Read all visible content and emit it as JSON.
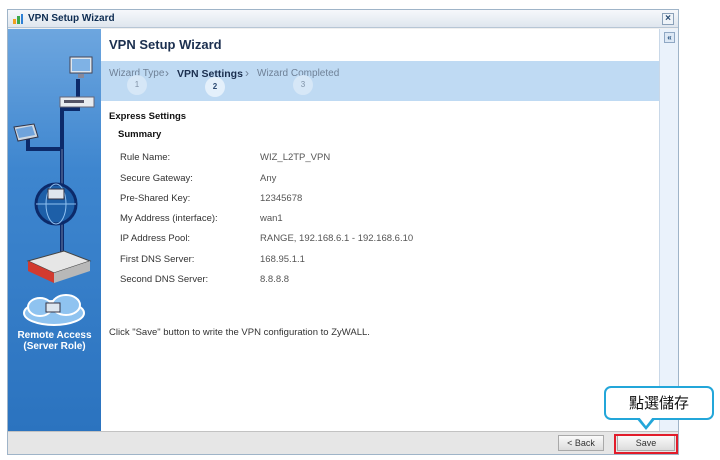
{
  "window": {
    "title": "VPN Setup Wizard",
    "close_icon": "close-icon"
  },
  "sidebar": {
    "role_line1": "Remote Access",
    "role_line2": "(Server Role)"
  },
  "main": {
    "title": "VPN Setup Wizard",
    "steps": [
      {
        "label": "Wizard Type",
        "number": "1",
        "active": false
      },
      {
        "label": "VPN Settings",
        "number": "2",
        "active": true
      },
      {
        "label": "Wizard Completed",
        "number": "3",
        "active": false
      }
    ],
    "section_title": "Express Settings",
    "summary_title": "Summary",
    "fields": [
      {
        "label": "Rule Name:",
        "value": "WIZ_L2TP_VPN"
      },
      {
        "label": "Secure Gateway:",
        "value": "Any"
      },
      {
        "label": "Pre-Shared Key:",
        "value": "12345678"
      },
      {
        "label": "My Address (interface):",
        "value": "wan1"
      },
      {
        "label": "IP Address Pool:",
        "value": "RANGE, 192.168.6.1 - 192.168.6.10"
      },
      {
        "label": "First DNS Server:",
        "value": "168.95.1.1"
      },
      {
        "label": "Second DNS Server:",
        "value": "8.8.8.8"
      }
    ],
    "note": "Click \"Save\" button to write the VPN configuration to ZyWALL."
  },
  "buttons": {
    "back_label": "< Back",
    "save_label": "Save"
  },
  "annotation": {
    "callout_text": "點選儲存",
    "highlight_color": "#e21c2a",
    "callout_border_color": "#23a6d9"
  },
  "colors": {
    "accent": "#3e86cf",
    "step_bar": "#bfdaf3"
  }
}
